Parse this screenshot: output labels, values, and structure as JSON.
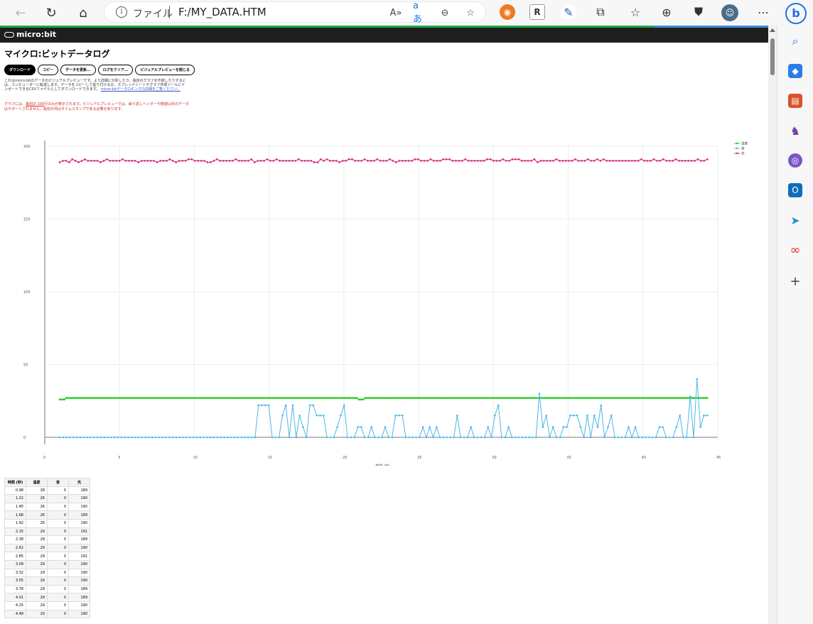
{
  "browser": {
    "address_label": "ファイル",
    "url": "F:/MY_DATA.HTM"
  },
  "page": {
    "brand": "micro:bit",
    "title": "マイクロ:ビットデータログ",
    "buttons": [
      "ダウンロード",
      "コピー",
      "データを更新...",
      "ログをクリア...",
      "ビジュアルプレビューを閉じる"
    ],
    "description": "これはmicro:bitのデータのビジュアルプレビューです。より詳細に分析したり、独自のグラフを作成したりするには、コンピューターに転送します。データをコピーして貼り付けるか、スプレッドシートやグラフ作成ツールにインポートできるCSVファイルとしてダウンロードできます。",
    "description_link": "micro:bitデータロギングの詳細をご覧ください。",
    "warning_pre": "グラフには、",
    "warning_link": "最初の 100",
    "warning_post": "行のみが表示されます。ビジュアルプレビューでは、繰り返しヘッダーや数値以外のデータはサポートされません。最初の列はタイムスタンプである必要があります。"
  },
  "chart_data": {
    "type": "line",
    "xlabel": "時間 (秒)",
    "ylabel": "",
    "xlim": [
      0,
      28
    ],
    "ylim": [
      0,
      200
    ],
    "xticks": [
      0,
      5,
      10,
      15,
      20,
      25,
      30,
      35,
      40,
      45
    ],
    "yticks": [
      0,
      50,
      100,
      150,
      200
    ],
    "legend_position": "top-right",
    "series": [
      {
        "name": "温度",
        "color": "#22cc22",
        "values": [
          26,
          26,
          26,
          26,
          27,
          27,
          27,
          27,
          27,
          27,
          27,
          27,
          27,
          27,
          27,
          27,
          27,
          27,
          27,
          27,
          27,
          27,
          27,
          27,
          27,
          27,
          27,
          27,
          27,
          27,
          27,
          27,
          27,
          27,
          27,
          27,
          27,
          27,
          27,
          27,
          27,
          27,
          27,
          27,
          27,
          27,
          27,
          27,
          27,
          27,
          27,
          27,
          27,
          27,
          27,
          27,
          27,
          27,
          27,
          27,
          27,
          27,
          27,
          27,
          27,
          27,
          27,
          27,
          27,
          27,
          27,
          27,
          27,
          27,
          27,
          27,
          27,
          27,
          27,
          27,
          27,
          27,
          27,
          27,
          27,
          27,
          27,
          27,
          27,
          27,
          27,
          27,
          27,
          27,
          27,
          27,
          27,
          27,
          27,
          27,
          27,
          27,
          27,
          27,
          27,
          27,
          27,
          27,
          27,
          27,
          27,
          27,
          27,
          27,
          27,
          27,
          27,
          27,
          27,
          27,
          27,
          27,
          27,
          27,
          27,
          27,
          27,
          27,
          27,
          27,
          27,
          27,
          27,
          27,
          27,
          27,
          27,
          27,
          27,
          27,
          27,
          27,
          27,
          27,
          27,
          27,
          27,
          27,
          27,
          27,
          27,
          27,
          27,
          27,
          27,
          27,
          27,
          27,
          27,
          27,
          27,
          27,
          27,
          27,
          27,
          27,
          27,
          27,
          27,
          27,
          27,
          27,
          27,
          27,
          27,
          27,
          27,
          27,
          27,
          27,
          27,
          27,
          27,
          27,
          27,
          27,
          26,
          26,
          26,
          26,
          27,
          27,
          27,
          27,
          27,
          27,
          27,
          27,
          27,
          27,
          27,
          27,
          27,
          27,
          27,
          27,
          27,
          27,
          27,
          27,
          27,
          27,
          27,
          27,
          27,
          27,
          27,
          27,
          27,
          27,
          27,
          27,
          27,
          27,
          27,
          27,
          27,
          27,
          27,
          27,
          27,
          27,
          27,
          27,
          27,
          27,
          27,
          27,
          27,
          27,
          27,
          27,
          27,
          27,
          27,
          27,
          27,
          27,
          27,
          27,
          27,
          27,
          27,
          27,
          27,
          27,
          27,
          27,
          27,
          27,
          27,
          27,
          27,
          27,
          27,
          27,
          27,
          27,
          27,
          27,
          27,
          27,
          27,
          27,
          27,
          27,
          27,
          27,
          27,
          27,
          27,
          27,
          27,
          27,
          27,
          27,
          27,
          27,
          27,
          27,
          27,
          27,
          27,
          27,
          27,
          27,
          27,
          27,
          27,
          27,
          27,
          27,
          27,
          27,
          27,
          27,
          27,
          27,
          27,
          27,
          27,
          27,
          27,
          27,
          27,
          27,
          27,
          27,
          27,
          27,
          27,
          27,
          27,
          27,
          27,
          27,
          27,
          27,
          27,
          27,
          27,
          27,
          27,
          27,
          27,
          27,
          27,
          27,
          27,
          27,
          27,
          27,
          27,
          27,
          27,
          27,
          27,
          27,
          27,
          27,
          27,
          27,
          27,
          27,
          27,
          27,
          27,
          27,
          27,
          27,
          27,
          27,
          27,
          27,
          27,
          27,
          27,
          27,
          27,
          27,
          27,
          27,
          27,
          27,
          27,
          27,
          27,
          27,
          27,
          27,
          27,
          27,
          27,
          27,
          27,
          27,
          27,
          27,
          27,
          27,
          27,
          27,
          27,
          27,
          27,
          27,
          27,
          27,
          27,
          27,
          27,
          27,
          27,
          27
        ]
      },
      {
        "name": "音",
        "color": "#4ab8e8",
        "values": [
          0,
          0,
          0,
          0,
          0,
          0,
          0,
          0,
          0,
          0,
          0,
          0,
          0,
          0,
          0,
          0,
          0,
          0,
          0,
          0,
          0,
          0,
          0,
          0,
          0,
          0,
          0,
          0,
          0,
          0,
          0,
          0,
          0,
          0,
          0,
          0,
          0,
          0,
          0,
          0,
          0,
          0,
          0,
          0,
          0,
          0,
          0,
          0,
          0,
          0,
          0,
          0,
          0,
          0,
          0,
          0,
          0,
          0,
          22,
          22,
          22,
          22,
          0,
          0,
          0,
          15,
          22,
          0,
          22,
          0,
          15,
          7,
          0,
          22,
          22,
          15,
          15,
          15,
          0,
          0,
          0,
          7,
          15,
          22,
          0,
          0,
          0,
          7,
          7,
          0,
          0,
          7,
          0,
          0,
          0,
          7,
          0,
          0,
          15,
          15,
          15,
          0,
          0,
          0,
          0,
          0,
          7,
          0,
          7,
          0,
          7,
          0,
          0,
          0,
          0,
          0,
          15,
          0,
          0,
          0,
          7,
          0,
          0,
          0,
          0,
          7,
          0,
          15,
          22,
          0,
          0,
          7,
          0,
          0,
          0,
          0,
          0,
          0,
          0,
          0,
          30,
          7,
          15,
          0,
          7,
          0,
          0,
          7,
          7,
          15,
          15,
          15,
          7,
          0,
          15,
          0,
          15,
          7,
          22,
          0,
          7,
          15,
          0,
          0,
          0,
          0,
          7,
          0,
          7,
          0,
          0,
          0,
          0,
          0,
          0,
          7,
          7,
          0,
          0,
          0,
          7,
          15,
          0,
          0,
          28,
          0,
          40,
          7,
          15,
          15
        ]
      },
      {
        "name": "光",
        "color": "#d8207a",
        "values": [
          189,
          190,
          190,
          189,
          191,
          190,
          189,
          190,
          191,
          190,
          190,
          190,
          190,
          189,
          190,
          191,
          190,
          190,
          190,
          190,
          191,
          190,
          190,
          190,
          190,
          189,
          190,
          190,
          190,
          190,
          190,
          189,
          190,
          190,
          190,
          191,
          190,
          189,
          190,
          190,
          190,
          191,
          191,
          190,
          190,
          190,
          190,
          189,
          189,
          190,
          191,
          190,
          190,
          190,
          190,
          190,
          191,
          190,
          190,
          190,
          190,
          191,
          189,
          190,
          190,
          190,
          191,
          190,
          190,
          191,
          190,
          190,
          190,
          190,
          190,
          190,
          191,
          190,
          190,
          190,
          190,
          189,
          189,
          191,
          190,
          191,
          190,
          190,
          190,
          189,
          190,
          190,
          191,
          191,
          190,
          190,
          190,
          191,
          190,
          190,
          190,
          191,
          190,
          190,
          190,
          191,
          190,
          189,
          190,
          190,
          190,
          190,
          190,
          191,
          191,
          190,
          190,
          190,
          191,
          190,
          190,
          190,
          191,
          191,
          191,
          190,
          190,
          190,
          190,
          191,
          190,
          190,
          190,
          190,
          190,
          190,
          191,
          191,
          190,
          190,
          190,
          191,
          190,
          190,
          191,
          191,
          191,
          190,
          190,
          190,
          190,
          191,
          189,
          190,
          190,
          190,
          190,
          190,
          191,
          190,
          190,
          190,
          190,
          190,
          191,
          190,
          190,
          190,
          191,
          190,
          190,
          191,
          190,
          191,
          190,
          190,
          190,
          190,
          190,
          190,
          190,
          190,
          190,
          190,
          190,
          191,
          190,
          190,
          190,
          191,
          190,
          190,
          191,
          190,
          190,
          190,
          191,
          190,
          190,
          190,
          190,
          190,
          190,
          191,
          190,
          190,
          191
        ]
      }
    ]
  },
  "table": {
    "headers": [
      "時間 (秒)",
      "温度",
      "音",
      "光"
    ],
    "rows": [
      [
        "0.98",
        "28",
        "0",
        "189"
      ],
      [
        "1.22",
        "26",
        "0",
        "190"
      ],
      [
        "1.45",
        "26",
        "0",
        "190"
      ],
      [
        "1.68",
        "26",
        "0",
        "189"
      ],
      [
        "1.92",
        "26",
        "0",
        "190"
      ],
      [
        "2.15",
        "29",
        "0",
        "191"
      ],
      [
        "2.38",
        "29",
        "0",
        "189"
      ],
      [
        "2.62",
        "29",
        "0",
        "190"
      ],
      [
        "2.85",
        "29",
        "0",
        "191"
      ],
      [
        "3.09",
        "29",
        "0",
        "190"
      ],
      [
        "3.32",
        "29",
        "0",
        "190"
      ],
      [
        "3.55",
        "29",
        "0",
        "190"
      ],
      [
        "3.78",
        "29",
        "0",
        "189"
      ],
      [
        "4.01",
        "29",
        "0",
        "189"
      ],
      [
        "4.25",
        "29",
        "0",
        "190"
      ],
      [
        "4.48",
        "29",
        "0",
        "190"
      ]
    ]
  }
}
